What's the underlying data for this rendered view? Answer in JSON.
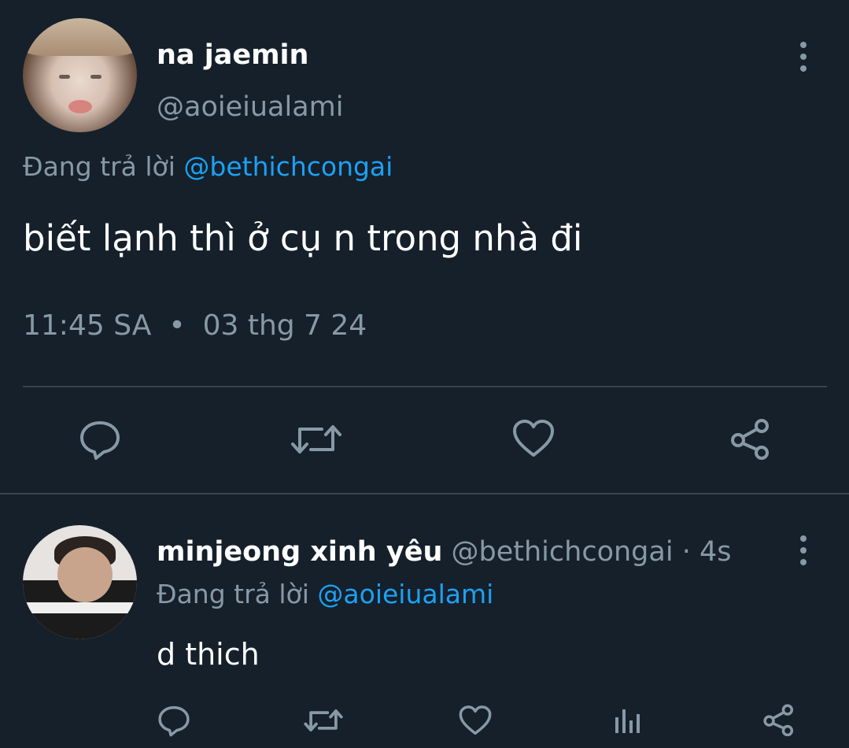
{
  "main_tweet": {
    "author_name": "na jaemin",
    "author_handle": "@aoieiualami",
    "reply_prefix": "Đang trả lời",
    "reply_to": "@bethichcongai",
    "text": "biết lạnh thì ở cụ n trong nhà đi",
    "time": "11:45 SA",
    "separator": "•",
    "date": "03 thg 7 24",
    "actions": [
      "reply-icon",
      "retweet-icon",
      "like-icon",
      "share-icon"
    ]
  },
  "reply_tweet": {
    "author_name": "minjeong xinh yêu",
    "author_handle": "@bethichcongai",
    "separator": "·",
    "age": "4s",
    "reply_prefix": "Đang trả lời",
    "reply_to": "@aoieiualami",
    "text": "d thich",
    "actions": [
      "reply-icon",
      "retweet-icon",
      "like-icon",
      "analytics-icon",
      "share-icon"
    ]
  },
  "colors": {
    "background": "#15202b",
    "secondary_text": "#8899a6",
    "mention": "#1da1f2",
    "divider": "#38444d"
  }
}
